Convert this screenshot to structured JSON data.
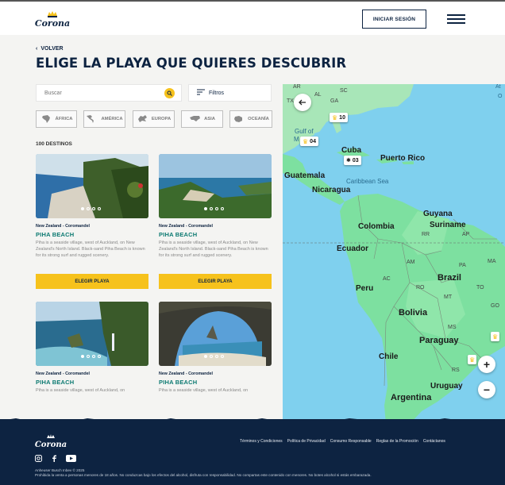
{
  "header": {
    "login_label": "INICIAR SESIÓN"
  },
  "page": {
    "back_label": "VOLVER",
    "title": "ELIGE LA PLAYA QUE QUIERES DESCUBRIR"
  },
  "search": {
    "placeholder": "Buscar",
    "filters_label": "Filtros"
  },
  "continents": [
    {
      "label": "ÁFRICA",
      "icon": "africa-icon"
    },
    {
      "label": "AMÉRICA",
      "icon": "america-icon"
    },
    {
      "label": "EUROPA",
      "icon": "europe-icon"
    },
    {
      "label": "ASIA",
      "icon": "asia-icon"
    },
    {
      "label": "OCEANÍA",
      "icon": "oceania-icon"
    }
  ],
  "results": {
    "count_label": "100 DESTINOS"
  },
  "cards": [
    {
      "location": "New Zealand - Coromandel",
      "name": "PIHA BEACH",
      "description": "Piha is a seaside village, west of Auckland, on New Zealand's North Island. Black-sand Piha Beach is known for its strong surf and rugged scenery.",
      "button": "ELEGIR PLAYA"
    },
    {
      "location": "New Zealand - Coromandel",
      "name": "PIHA BEACH",
      "description": "Piha is a seaside village, west of Auckland, on New Zealand's North Island. Black-sand Piha Beach is known for its strong surf and rugged scenery.",
      "button": "ELEGIR PLAYA"
    },
    {
      "location": "New Zealand - Coromandel",
      "name": "PIHA BEACH",
      "description": "Piha is a seaside village, west of Auckland, on"
    },
    {
      "location": "New Zealand - Coromandel",
      "name": "PIHA BEACH",
      "description": "Piha is a seaside village, west of Auckland, on"
    }
  ],
  "map": {
    "labels": {
      "ar": "AR",
      "sc": "SC",
      "gulf": "Gulf of",
      "gulf_m": "M",
      "cuba": "Cuba",
      "puerto_rico": "Puerto Rico",
      "guatemala": "Guatemala",
      "caribbean": "Caribbean Sea",
      "nicaragua": "Nicaragua",
      "guyana": "Guyana",
      "suriname": "Suriname",
      "colombia": "Colombia",
      "rr": "RR",
      "ap": "AP",
      "ecuador": "Ecuador",
      "am": "AM",
      "pa": "PA",
      "ma": "MA",
      "brazil": "Brazil",
      "ac": "AC",
      "peru": "Peru",
      "ro": "RO",
      "to": "TO",
      "mt": "MT",
      "go": "GO",
      "bolivia": "Bolivia",
      "ms": "MS",
      "paraguay": "Paraguay",
      "chile": "Chile",
      "rs": "RS",
      "uruguay": "Uruguay",
      "argentina": "Argentina",
      "at": "At",
      "o": "O",
      "al": "AL",
      "tx": "TX",
      "ga": "GA"
    },
    "markers": [
      {
        "count": "10"
      },
      {
        "count": "04"
      },
      {
        "count": "03"
      }
    ],
    "zoom_in": "+",
    "zoom_out": "−"
  },
  "footer": {
    "links": [
      "Términos y Condiciones",
      "Política de Privacidad",
      "Consumo Responsable",
      "Reglas de la Promoción",
      "Contáctanos"
    ],
    "copyright": "Anheuser Busch Inbev © 2025",
    "legal": "Prohibida la venta a personas menores de 18 años. No conduzcas bajo los efectos del alcohol, disfruta con responsabilidad. No compartas este contenido con menores. No botes alcohol si estás embarazada."
  },
  "colors": {
    "navy": "#0d2341",
    "accent": "#f6c21c",
    "teal": "#0d7a72"
  }
}
